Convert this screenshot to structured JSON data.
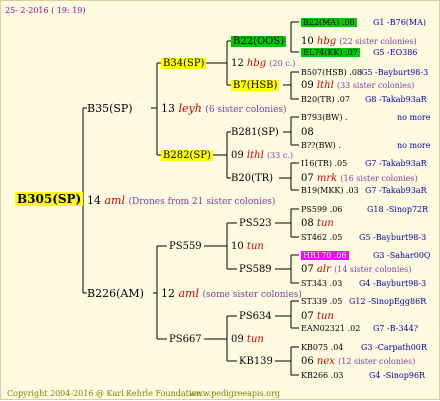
{
  "header": {
    "date": "25- 2-2016 ( 19: 19)"
  },
  "root": {
    "id": "B305(SP)",
    "num": "14",
    "race": "aml",
    "note": "(Drones from 21 sister colonies)"
  },
  "gen1": {
    "upper": {
      "id": "B35(SP)",
      "num": "13",
      "race": "leyh",
      "note": "(6 sister colonies)"
    },
    "lower": {
      "id": "B226(AM)",
      "num": "12",
      "race": "aml",
      "note": "(some sister colonies)"
    }
  },
  "gen2": {
    "b34": {
      "id": "B34(SP)",
      "num": "12",
      "race": "hbg",
      "note": "(20 c.)"
    },
    "b282": {
      "id": "B282(SP)",
      "num": "09",
      "race": "lthl",
      "note": "(33 c.)"
    },
    "ps559": {
      "id": "PS559",
      "num": "10",
      "race": "tun"
    },
    "ps667": {
      "id": "PS667",
      "num": "09",
      "race": "tun"
    }
  },
  "gen3": {
    "b22": {
      "id": "B22(OOS)",
      "num": "10",
      "race": "hbg",
      "note": "(22 sister colonies)"
    },
    "b7": {
      "id": "B7(HSB)",
      "num": "09",
      "race": "lthl",
      "note": "(33 sister colonies)"
    },
    "b281": {
      "id": "B281(SP)",
      "num": "08"
    },
    "b20": {
      "id": "B20(TR)",
      "num": "07",
      "race": "mrk",
      "note": "(16 sister colonies)"
    },
    "ps523": {
      "id": "PS523",
      "num": "08",
      "race": "tun"
    },
    "ps589": {
      "id": "PS589",
      "num": "07",
      "race": "alr",
      "note": "(14 sister colonies)"
    },
    "ps634": {
      "id": "PS634",
      "num": "07",
      "race": "tun"
    },
    "kb139": {
      "id": "KB139",
      "num": "06",
      "race": "nex",
      "note": "(12 sister colonies)"
    }
  },
  "gen4": {
    "b22_ma": {
      "id": "B22(MA) .08",
      "link": "G1 -B76(MA)"
    },
    "el74": {
      "id": "EL74(KK) .07",
      "link": "G5 -EO386"
    },
    "b507": {
      "id": "B507(HSB) .08",
      "link": "G5 -Bayburt98-3"
    },
    "b20_tr": {
      "id": "B20(TR) .07",
      "link": "G8 -Takab93aR"
    },
    "b793": {
      "id": "B793(BW) .",
      "link": "no more"
    },
    "bqq": {
      "id": "B??(BW) .",
      "link": "no more"
    },
    "i16": {
      "id": "I16(TR) .05",
      "link": "G7 -Takab93aR"
    },
    "b19": {
      "id": "B19(MKK) .03",
      "link": "G7 -Takab93aR"
    },
    "ps599": {
      "id": "PS599 .06",
      "link": "G18 -Sinop72R"
    },
    "st462": {
      "id": "ST462 .05",
      "link": "G5 -Bayburt98-3"
    },
    "hr170": {
      "id": "HR170 .06",
      "link": "G3 -Sahar00Q"
    },
    "st343": {
      "id": "ST343 .03",
      "link": "G4 -Bayburt98-3"
    },
    "st339": {
      "id": "ST339 .05",
      "link": "G12 -SinopEgg86R"
    },
    "ean": {
      "id": "EAN02321 .02",
      "link": "G7 -B-344?"
    },
    "kb075": {
      "id": "KB075 .04",
      "link": "G3 -Carpath00R"
    },
    "kb266": {
      "id": "KB266 .03",
      "link": "G4 -Sinop96R"
    }
  },
  "footer": {
    "copyright": "Copyright 2004-2016 @ Karl Kehrle Foundation.",
    "url": "www.pedigreeapis.org"
  },
  "colors": {
    "background": "#fffbe0",
    "yellow": "#ffff00",
    "green": "#00c800",
    "magenta": "#ff00ff",
    "blue": "#0000b0",
    "purple": "#8040a0",
    "red": "#d00000"
  }
}
